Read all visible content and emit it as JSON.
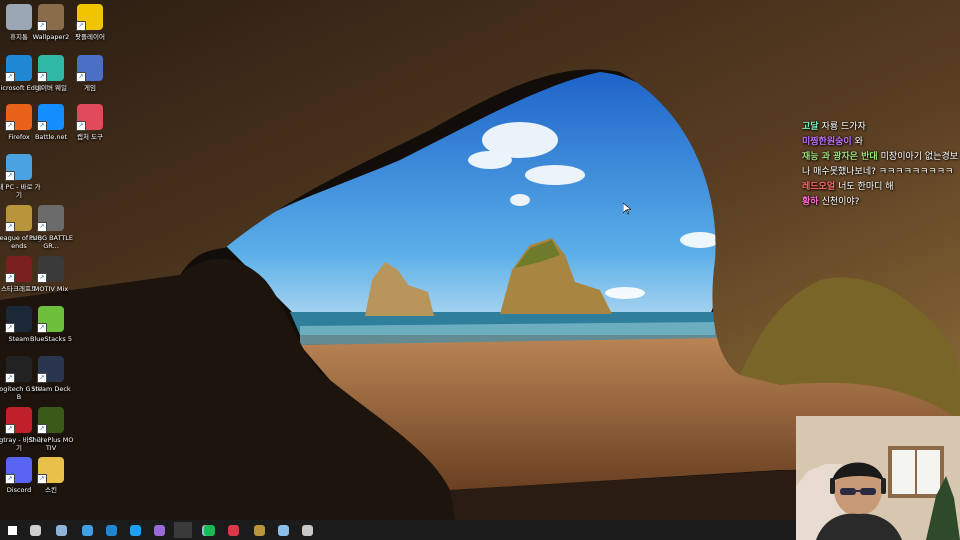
{
  "desktop": {
    "icons": [
      {
        "label": "휴지통",
        "icon": "recycle-bin-icon",
        "color": "#9aa7b4"
      },
      {
        "label": "Wallpaper2",
        "icon": "wallpaper-file-icon",
        "color": "#8a6b4a"
      },
      {
        "label": "팟플레이어",
        "icon": "potplayer-icon",
        "color": "#f2c400"
      },
      {
        "label": "Microsoft Edge",
        "icon": "edge-icon",
        "color": "#1e88d4"
      },
      {
        "label": "네이버 웨일",
        "icon": "whale-browser-icon",
        "color": "#2fb8a6"
      },
      {
        "label": "게임",
        "icon": "game-folder-icon",
        "color": "#4a6fc4"
      },
      {
        "label": "Firefox",
        "icon": "firefox-icon",
        "color": "#e8621a"
      },
      {
        "label": "Battle.net",
        "icon": "battlenet-icon",
        "color": "#148eff"
      },
      {
        "label": "캡처 도구",
        "icon": "snipping-tool-icon",
        "color": "#e04a5a"
      },
      {
        "label": "내 PC - 바로 가기",
        "icon": "this-pc-icon",
        "color": "#4aa3e0"
      },
      {
        "label": "League of Legends",
        "icon": "league-of-legends-icon",
        "color": "#b8953a"
      },
      {
        "label": "PUBG BATTLEGR...",
        "icon": "pubg-icon",
        "color": "#6b6b6b"
      },
      {
        "label": "스타크래프트",
        "icon": "starcraft-icon",
        "color": "#7a2020"
      },
      {
        "label": "MOTIV Mix",
        "icon": "motiv-mix-icon",
        "color": "#3a3a3a"
      },
      {
        "label": "Steam",
        "icon": "steam-icon",
        "color": "#1b2838"
      },
      {
        "label": "BlueStacks 5",
        "icon": "bluestacks-icon",
        "color": "#6dbf3c"
      },
      {
        "label": "Logitech G HUB",
        "icon": "logitech-ghub-icon",
        "color": "#222222"
      },
      {
        "label": "Steam Deck",
        "icon": "steam-deck-icon",
        "color": "#2a3550"
      },
      {
        "label": "vgtray - 바로 가기",
        "icon": "vanguard-icon",
        "color": "#c0202a"
      },
      {
        "label": "ShurePlus MOTIV",
        "icon": "shureplus-motiv-icon",
        "color": "#3a5a1a"
      },
      {
        "label": "Discord",
        "icon": "discord-icon",
        "color": "#5865f2"
      },
      {
        "label": "스킨",
        "icon": "folder-icon",
        "color": "#e8c04a"
      }
    ]
  },
  "chat": {
    "messages": [
      {
        "user": "고달",
        "text": "자룡 드가자",
        "color": "#7ff0c0"
      },
      {
        "user": "미찡한원숭이",
        "text": "와",
        "color": "#c070ff"
      },
      {
        "user": "재능 과 광자은 반대",
        "text": "미장이아기 없는경보나 매수못했나보네? ㅋㅋㅋㅋㅋㅋㅋㅋㅋ",
        "color": "#9fe07a"
      },
      {
        "user": "레드오얼",
        "text": "너도 한마디 해",
        "color": "#ff6a6a"
      },
      {
        "user": "황하",
        "text": "신천이야?",
        "color": "#ff6ad0"
      }
    ]
  },
  "taskbar": {
    "items": [
      {
        "icon": "start-icon",
        "color": "#ffffff"
      },
      {
        "icon": "task-view-icon",
        "color": "#cfcfcf"
      },
      {
        "icon": "calculator-icon",
        "color": "#8fb4d8"
      },
      {
        "icon": "explorer-pin-icon",
        "color": "#3fa0e8"
      },
      {
        "icon": "edge-taskbar-icon",
        "color": "#1e88d4"
      },
      {
        "icon": "twitter-icon",
        "color": "#1da1f2"
      },
      {
        "icon": "obs-like-icon",
        "color": "#9a6ad8"
      },
      {
        "icon": "obs-icon",
        "color": "#3a3a3a"
      },
      {
        "icon": "steam-taskbar-icon",
        "color": "#a0b8d0"
      },
      {
        "icon": "spotify-icon",
        "color": "#1db954"
      },
      {
        "icon": "app-red-icon",
        "color": "#d83a4a"
      },
      {
        "icon": "league-taskbar-icon",
        "color": "#b8953a"
      },
      {
        "icon": "notes-icon",
        "color": "#8ac0e8"
      },
      {
        "icon": "shield-app-icon",
        "color": "#c8c8c8"
      }
    ]
  }
}
